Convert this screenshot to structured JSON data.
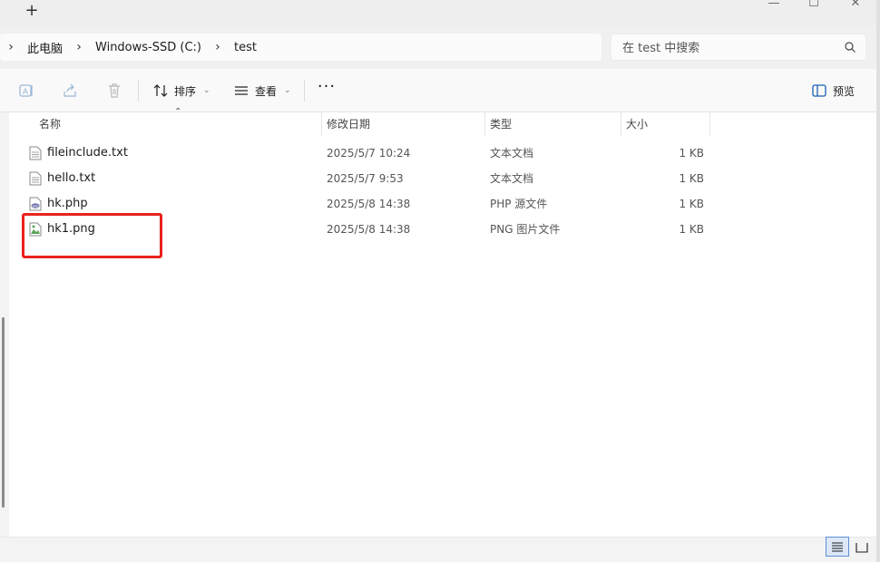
{
  "titlebar": {
    "new_tab": "+",
    "minimize": "—",
    "maximize": "☐",
    "close": "✕"
  },
  "address": {
    "crumbs": [
      "此电脑",
      "Windows-SSD (C:)",
      "test"
    ]
  },
  "search": {
    "placeholder": "在 test 中搜索"
  },
  "commandbar": {
    "sort_label": "排序",
    "view_label": "查看",
    "more": "···",
    "preview_label": "预览"
  },
  "columns": {
    "name": "名称",
    "date": "修改日期",
    "type": "类型",
    "size": "大小"
  },
  "files": [
    {
      "name": "fileinclude.txt",
      "date": "2025/5/7 10:24",
      "type": "文本文档",
      "size": "1 KB",
      "icon": "text-file-icon"
    },
    {
      "name": "hello.txt",
      "date": "2025/5/7 9:53",
      "type": "文本文档",
      "size": "1 KB",
      "icon": "text-file-icon"
    },
    {
      "name": "hk.php",
      "date": "2025/5/8 14:38",
      "type": "PHP 源文件",
      "size": "1 KB",
      "icon": "php-file-icon"
    },
    {
      "name": "hk1.png",
      "date": "2025/5/8 14:38",
      "type": "PNG 图片文件",
      "size": "1 KB",
      "icon": "image-file-icon"
    }
  ],
  "colors": {
    "highlight": "#e8231c",
    "accent": "#5a8fd6"
  }
}
